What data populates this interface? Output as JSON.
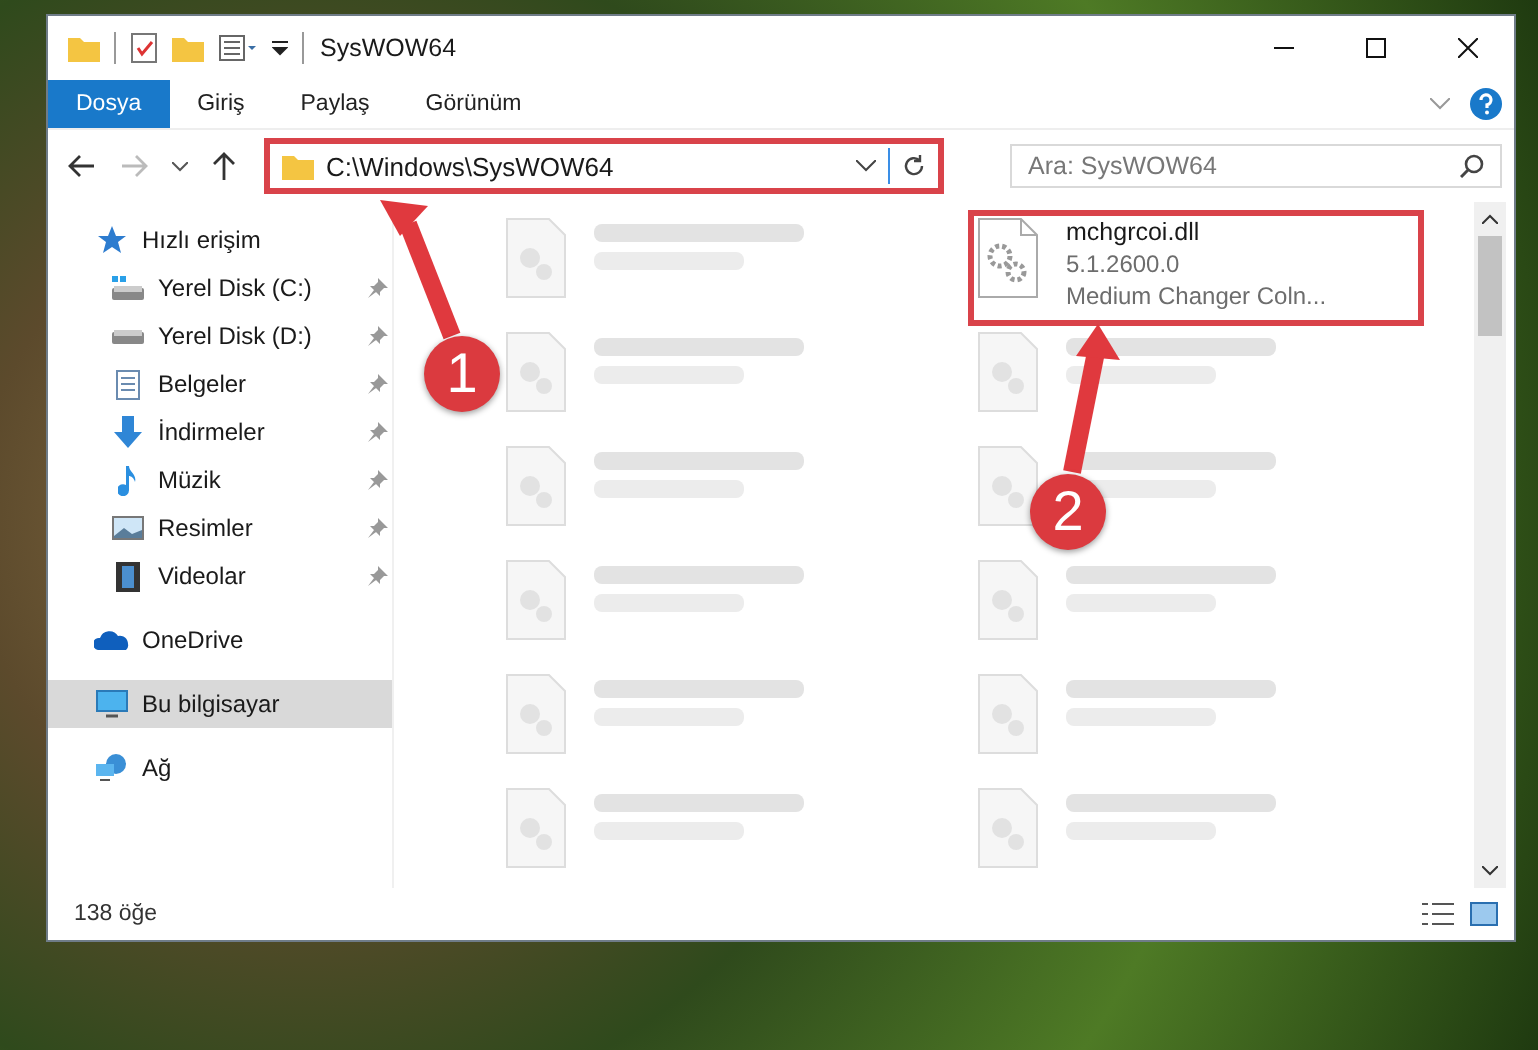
{
  "window": {
    "title": "SysWOW64"
  },
  "ribbon_tabs": [
    {
      "label": "Dosya",
      "selected": true
    },
    {
      "label": "Giriş",
      "selected": false
    },
    {
      "label": "Paylaş",
      "selected": false
    },
    {
      "label": "Görünüm",
      "selected": false
    }
  ],
  "address_bar": {
    "path": "C:\\Windows\\SysWOW64",
    "highlighted": true
  },
  "search": {
    "placeholder": "Ara: SysWOW64"
  },
  "sidebar": {
    "items": [
      {
        "label": "Hızlı erişim",
        "kind": "quick-access",
        "selected": false,
        "children": [
          {
            "label": "Yerel Disk (C:)",
            "kind": "system-drive",
            "pinned": true,
            "selected": false
          },
          {
            "label": "Yerel Disk (D:)",
            "kind": "drive",
            "pinned": true,
            "selected": false
          },
          {
            "label": "Belgeler",
            "kind": "documents",
            "pinned": true,
            "selected": false
          },
          {
            "label": "İndirmeler",
            "kind": "downloads",
            "pinned": true,
            "selected": false
          },
          {
            "label": "Müzik",
            "kind": "music",
            "pinned": true,
            "selected": false
          },
          {
            "label": "Resimler",
            "kind": "pictures",
            "pinned": true,
            "selected": false
          },
          {
            "label": "Videolar",
            "kind": "videos",
            "pinned": true,
            "selected": false
          }
        ]
      },
      {
        "label": "OneDrive",
        "kind": "cloud",
        "selected": false
      },
      {
        "label": "Bu bilgisayar",
        "kind": "computer",
        "selected": true
      },
      {
        "label": "Ağ",
        "kind": "network",
        "selected": false
      }
    ]
  },
  "files": [
    {
      "highlighted": false,
      "dimmed": true
    },
    {
      "name": "mchgrcoi.dll",
      "lines": [
        "5.1.2600.0",
        "Medium Changer Coln..."
      ],
      "highlighted": true,
      "dimmed": false
    },
    {
      "highlighted": false,
      "dimmed": true
    },
    {
      "highlighted": false,
      "dimmed": true
    },
    {
      "highlighted": false,
      "dimmed": true
    },
    {
      "highlighted": false,
      "dimmed": true
    },
    {
      "highlighted": false,
      "dimmed": true
    },
    {
      "highlighted": false,
      "dimmed": true
    },
    {
      "highlighted": false,
      "dimmed": true
    },
    {
      "highlighted": false,
      "dimmed": true
    },
    {
      "highlighted": false,
      "dimmed": true
    },
    {
      "highlighted": false,
      "dimmed": true
    }
  ],
  "status_bar": {
    "count": "138 öğe"
  },
  "annotations": [
    {
      "number": "1"
    },
    {
      "number": "2"
    }
  ]
}
